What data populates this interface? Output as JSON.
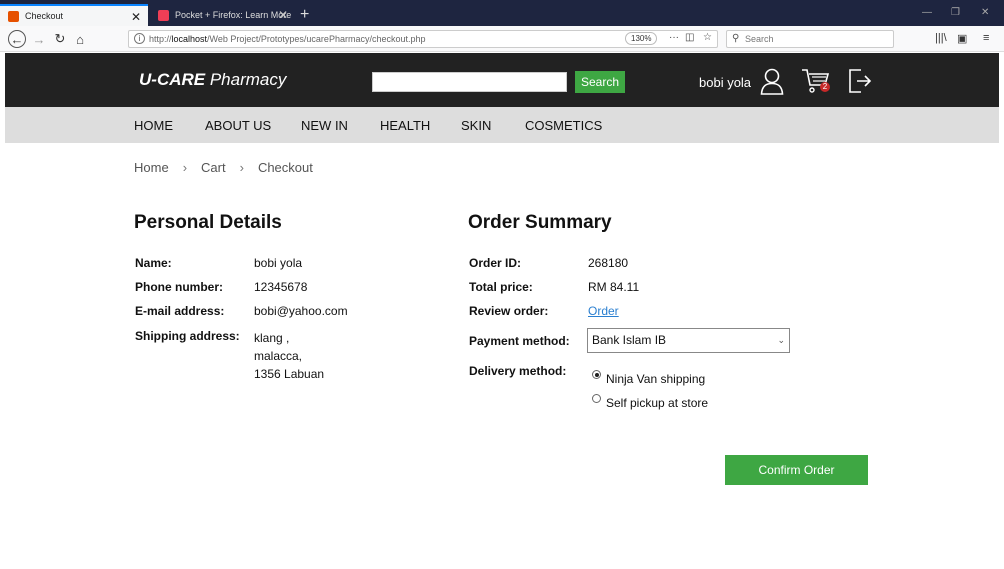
{
  "browser": {
    "tabs": [
      {
        "title": "Checkout",
        "active": true
      },
      {
        "title": "Pocket + Firefox: Learn More",
        "active": false
      }
    ],
    "url_prefix": "http://",
    "url_host": "localhost",
    "url_path": "/Web Project/Prototypes/ucarePharmacy/checkout.php",
    "zoom": "130%",
    "search_placeholder": "Search"
  },
  "header": {
    "logo_bold": "U-CARE",
    "logo_rest": " Pharmacy",
    "search_button": "Search",
    "username": "bobi yola",
    "cart_count": "2"
  },
  "menu": [
    "HOME",
    "ABOUT US",
    "NEW IN",
    "HEALTH",
    "SKIN",
    "COSMETICS"
  ],
  "breadcrumb": [
    "Home",
    "Cart",
    "Checkout"
  ],
  "personal": {
    "title": "Personal Details",
    "name_label": "Name:",
    "name": "bobi yola",
    "phone_label": "Phone number:",
    "phone": "12345678",
    "email_label": "E-mail address:",
    "email": "bobi@yahoo.com",
    "address_label": "Shipping address:",
    "address_line1": "klang ,",
    "address_line2": "malacca,",
    "address_line3": "1356 Labuan"
  },
  "summary": {
    "title": "Order Summary",
    "order_id_label": "Order ID:",
    "order_id": "268180",
    "total_label": "Total price:",
    "total": "RM 84.11",
    "review_label": "Review order:",
    "review_link": "Order",
    "payment_label": "Payment method:",
    "payment_selected": "Bank Islam IB",
    "delivery_label": "Delivery method:",
    "delivery_options": [
      "Ninja Van shipping",
      "Self pickup at store"
    ],
    "delivery_selected": 0
  },
  "confirm_button": "Confirm Order",
  "colors": {
    "accent": "#3ea743",
    "header_bg": "#222222",
    "menu_bg": "#dddddd",
    "link": "#2a7fd0"
  }
}
